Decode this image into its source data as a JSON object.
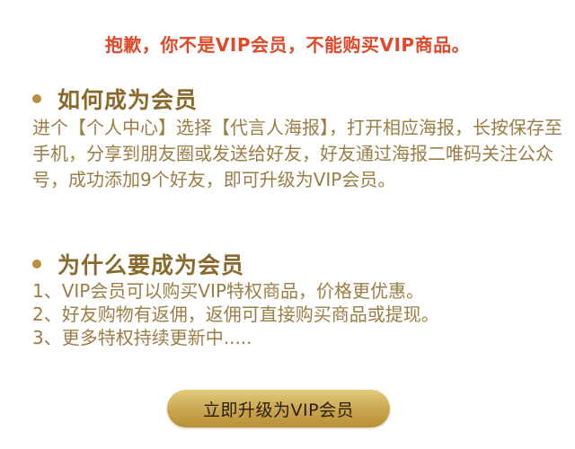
{
  "notice": {
    "text": "抱歉，你不是VIP会员，不能购买VIP商品。",
    "color": "#e0482a"
  },
  "how_section": {
    "title": "如何成为会员",
    "body": "进个【个人中心】选择【代言人海报】，打开相应海报，长按保存至手机，分享到朋友圈或发送给好友，好友通过海报二唯码关注公众号，成功添加9个好友，即可升级为VIP会员。"
  },
  "why_section": {
    "title": "为什么要成为会员",
    "items": [
      "1、VIP会员可以购买VIP特权商品，价格更优惠。",
      "2、好友购物有返佣，返佣可直接购买商品或提现。",
      "3、更多特权持续更新中....."
    ]
  },
  "upgrade_button": {
    "label": "立即升级为VIP会员"
  },
  "colors": {
    "heading": "#8a6a2c",
    "body_text": "#9a7d45",
    "bullet": "#b8913f",
    "button_gold": "#c9a54f"
  },
  "icons": {
    "bullet": "gold-dot"
  }
}
